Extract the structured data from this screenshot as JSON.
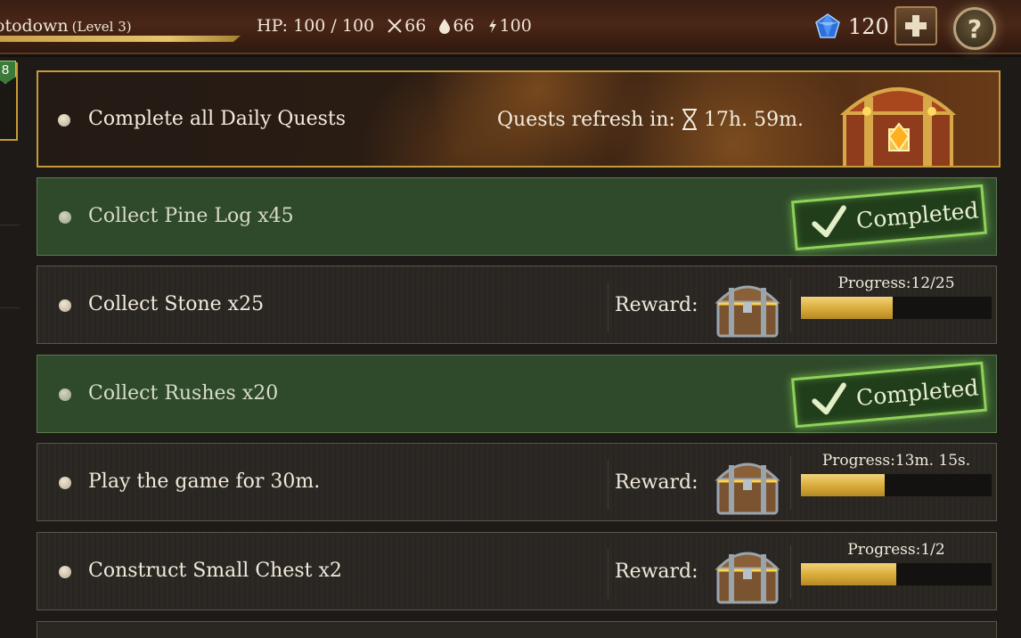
{
  "player": {
    "name": "otodown",
    "level": "(Level 3)"
  },
  "stats": {
    "hp": "HP: 100 / 100",
    "attack": "66",
    "defense": "66",
    "energy": "100"
  },
  "currency": {
    "gems": "120"
  },
  "side": {
    "badge": "8"
  },
  "daily": {
    "title": "Complete all Daily Quests",
    "refresh_label": "Quests refresh in:",
    "refresh_time": "17h. 59m."
  },
  "quests": [
    {
      "title": "Collect Pine Log x45",
      "status": "Completed"
    },
    {
      "title": "Collect Stone x25",
      "reward_label": "Reward:",
      "progress": "Progress:12/25",
      "fraction": 0.48
    },
    {
      "title": "Collect Rushes x20",
      "status": "Completed"
    },
    {
      "title": "Play the game for 30m.",
      "reward_label": "Reward:",
      "progress": "Progress:13m. 15s.",
      "fraction": 0.44
    },
    {
      "title": "Construct Small Chest x2",
      "reward_label": "Reward:",
      "progress": "Progress:1/2",
      "fraction": 0.5
    }
  ],
  "colors": {
    "gold": "#c79a38",
    "completed_green": "#8fd25a",
    "progress_fill": "#d8aa38"
  },
  "icons": [
    "sword-icon",
    "drop-icon",
    "lightning-icon",
    "gem-icon",
    "plus-icon",
    "help-icon",
    "hourglass-icon",
    "check-icon",
    "treasure-chest-icon",
    "reward-chest-icon"
  ]
}
